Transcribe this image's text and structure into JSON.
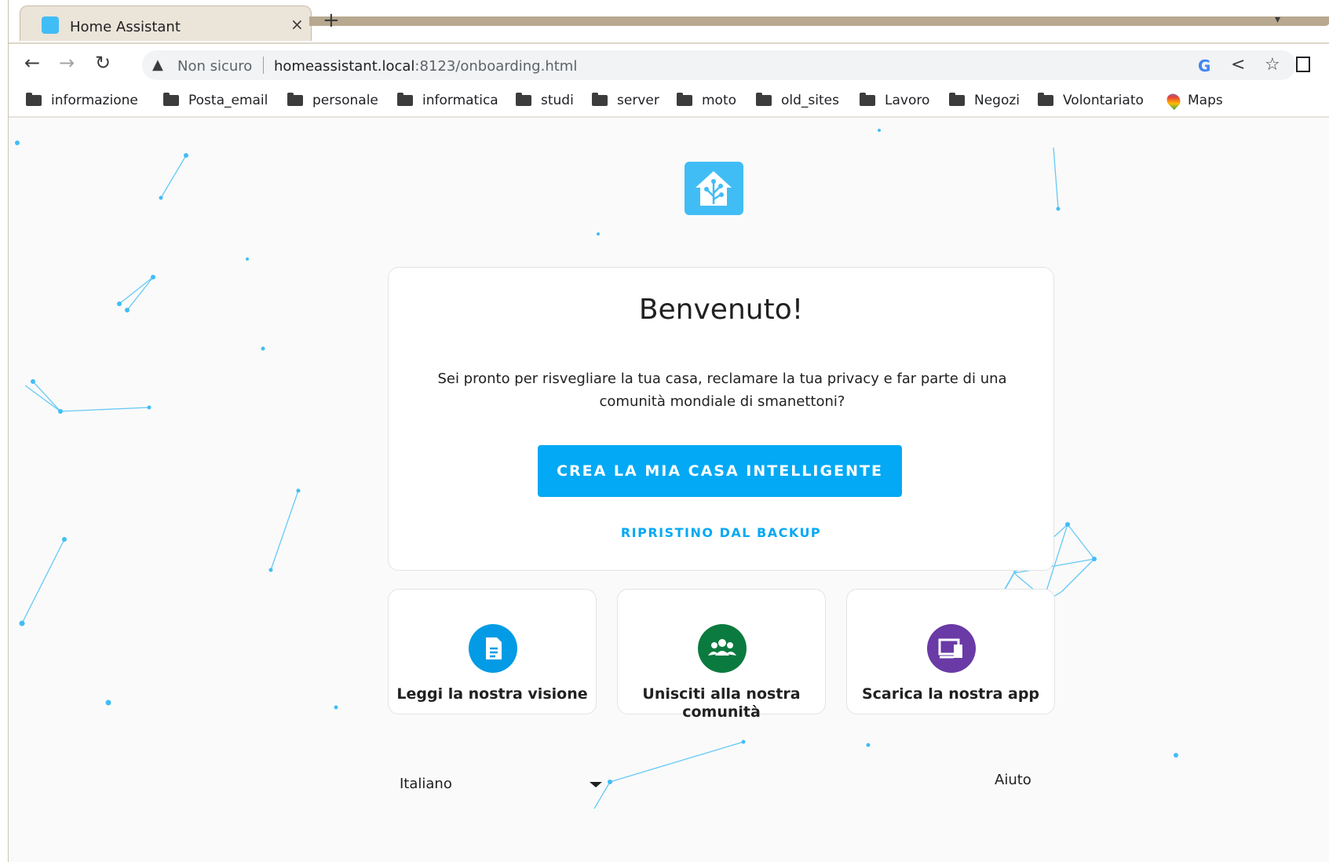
{
  "browser": {
    "tab": {
      "title": "Home Assistant",
      "close": "×",
      "new_tab": "+"
    },
    "toolbar": {
      "back": "←",
      "forward": "→",
      "reload": "↻",
      "security_warning": "Non sicuro",
      "url_host": "homeassistant.local",
      "url_rest": ":8123/onboarding.html",
      "icons": [
        "google-icon",
        "share-icon",
        "star-icon",
        "extension-icon"
      ]
    },
    "bookmarks": [
      "informazione",
      "Posta_email",
      "personale",
      "informatica",
      "studi",
      "server",
      "moto",
      "old_sites",
      "Lavoro",
      "Negozi",
      "Volontariato",
      "Maps"
    ]
  },
  "onboarding": {
    "title": "Benvenuto!",
    "intro": "Sei pronto per risvegliare la tua casa, reclamare la tua privacy e far parte di una comunità mondiale di smanettoni?",
    "primary_button": "CREA LA MIA CASA INTELLIGENTE",
    "restore_link": "RIPRISTINO DAL BACKUP",
    "features": [
      {
        "label": "Leggi la nostra visione",
        "icon": "document-icon",
        "color": "#039be5"
      },
      {
        "label": "Unisciti alla nostra comunità",
        "icon": "community-icon",
        "color": "#0b7a3e"
      },
      {
        "label": "Scarica la nostra app",
        "icon": "devices-icon",
        "color": "#6a3aa6"
      }
    ],
    "footer": {
      "language": "Italiano",
      "help": "Aiuto"
    }
  },
  "colors": {
    "accent": "#03a9f4",
    "logo": "#41bdf5",
    "tab_bar": "#ebe4d8"
  }
}
